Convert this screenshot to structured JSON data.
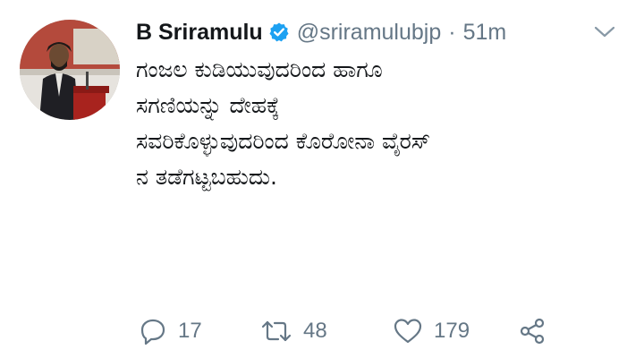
{
  "tweet": {
    "display_name": "B Sriramulu",
    "verified_icon": "verified-badge-icon",
    "handle": "@sriramulubjp",
    "separator": "·",
    "time": "51m",
    "menu_icon": "chevron-down-icon",
    "text_lines": [
      "ಗಂಜಲ ಕುಡಿಯುವುದರಿಂದ ಹಾಗೂ",
      "ಸಗಣಿಯನ್ನು ದೇಹಕ್ಕೆ",
      "ಸವರಿಕೊಳ್ಳುವುದರಿಂದ ಕೊರೋನಾ ವೈರಸ್",
      "ನ ತಡೆಗಟ್ಟಬಹುದು."
    ],
    "actions": {
      "reply": {
        "icon": "reply-icon",
        "count": "17"
      },
      "retweet": {
        "icon": "retweet-icon",
        "count": "48"
      },
      "like": {
        "icon": "heart-icon",
        "count": "179"
      },
      "share": {
        "icon": "share-icon"
      }
    }
  },
  "colors": {
    "text": "#14171a",
    "secondary": "#657786",
    "verified": "#1da1f2"
  }
}
